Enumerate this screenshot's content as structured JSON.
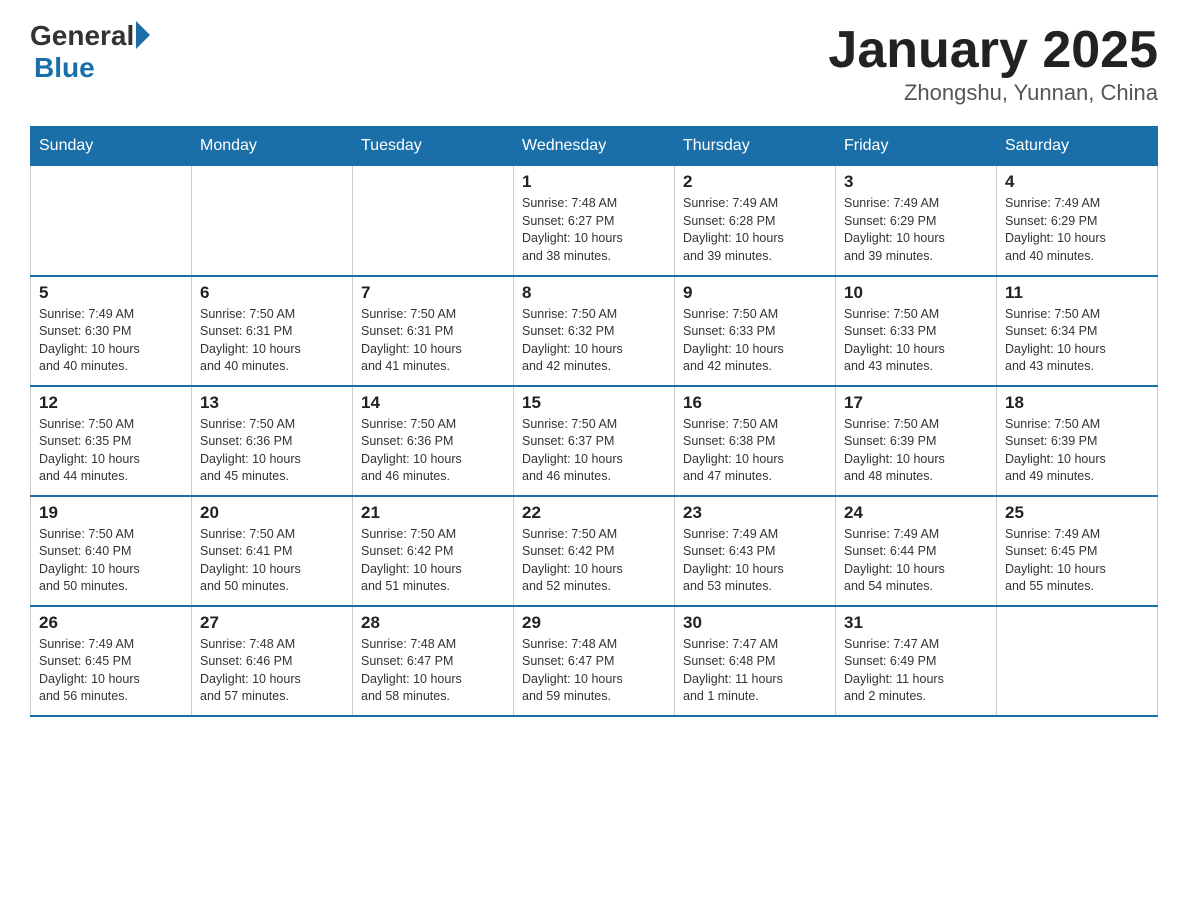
{
  "header": {
    "logo_general": "General",
    "logo_blue": "Blue",
    "month_title": "January 2025",
    "location": "Zhongshu, Yunnan, China"
  },
  "days_of_week": [
    "Sunday",
    "Monday",
    "Tuesday",
    "Wednesday",
    "Thursday",
    "Friday",
    "Saturday"
  ],
  "weeks": [
    [
      {
        "day": "",
        "info": ""
      },
      {
        "day": "",
        "info": ""
      },
      {
        "day": "",
        "info": ""
      },
      {
        "day": "1",
        "info": "Sunrise: 7:48 AM\nSunset: 6:27 PM\nDaylight: 10 hours\nand 38 minutes."
      },
      {
        "day": "2",
        "info": "Sunrise: 7:49 AM\nSunset: 6:28 PM\nDaylight: 10 hours\nand 39 minutes."
      },
      {
        "day": "3",
        "info": "Sunrise: 7:49 AM\nSunset: 6:29 PM\nDaylight: 10 hours\nand 39 minutes."
      },
      {
        "day": "4",
        "info": "Sunrise: 7:49 AM\nSunset: 6:29 PM\nDaylight: 10 hours\nand 40 minutes."
      }
    ],
    [
      {
        "day": "5",
        "info": "Sunrise: 7:49 AM\nSunset: 6:30 PM\nDaylight: 10 hours\nand 40 minutes."
      },
      {
        "day": "6",
        "info": "Sunrise: 7:50 AM\nSunset: 6:31 PM\nDaylight: 10 hours\nand 40 minutes."
      },
      {
        "day": "7",
        "info": "Sunrise: 7:50 AM\nSunset: 6:31 PM\nDaylight: 10 hours\nand 41 minutes."
      },
      {
        "day": "8",
        "info": "Sunrise: 7:50 AM\nSunset: 6:32 PM\nDaylight: 10 hours\nand 42 minutes."
      },
      {
        "day": "9",
        "info": "Sunrise: 7:50 AM\nSunset: 6:33 PM\nDaylight: 10 hours\nand 42 minutes."
      },
      {
        "day": "10",
        "info": "Sunrise: 7:50 AM\nSunset: 6:33 PM\nDaylight: 10 hours\nand 43 minutes."
      },
      {
        "day": "11",
        "info": "Sunrise: 7:50 AM\nSunset: 6:34 PM\nDaylight: 10 hours\nand 43 minutes."
      }
    ],
    [
      {
        "day": "12",
        "info": "Sunrise: 7:50 AM\nSunset: 6:35 PM\nDaylight: 10 hours\nand 44 minutes."
      },
      {
        "day": "13",
        "info": "Sunrise: 7:50 AM\nSunset: 6:36 PM\nDaylight: 10 hours\nand 45 minutes."
      },
      {
        "day": "14",
        "info": "Sunrise: 7:50 AM\nSunset: 6:36 PM\nDaylight: 10 hours\nand 46 minutes."
      },
      {
        "day": "15",
        "info": "Sunrise: 7:50 AM\nSunset: 6:37 PM\nDaylight: 10 hours\nand 46 minutes."
      },
      {
        "day": "16",
        "info": "Sunrise: 7:50 AM\nSunset: 6:38 PM\nDaylight: 10 hours\nand 47 minutes."
      },
      {
        "day": "17",
        "info": "Sunrise: 7:50 AM\nSunset: 6:39 PM\nDaylight: 10 hours\nand 48 minutes."
      },
      {
        "day": "18",
        "info": "Sunrise: 7:50 AM\nSunset: 6:39 PM\nDaylight: 10 hours\nand 49 minutes."
      }
    ],
    [
      {
        "day": "19",
        "info": "Sunrise: 7:50 AM\nSunset: 6:40 PM\nDaylight: 10 hours\nand 50 minutes."
      },
      {
        "day": "20",
        "info": "Sunrise: 7:50 AM\nSunset: 6:41 PM\nDaylight: 10 hours\nand 50 minutes."
      },
      {
        "day": "21",
        "info": "Sunrise: 7:50 AM\nSunset: 6:42 PM\nDaylight: 10 hours\nand 51 minutes."
      },
      {
        "day": "22",
        "info": "Sunrise: 7:50 AM\nSunset: 6:42 PM\nDaylight: 10 hours\nand 52 minutes."
      },
      {
        "day": "23",
        "info": "Sunrise: 7:49 AM\nSunset: 6:43 PM\nDaylight: 10 hours\nand 53 minutes."
      },
      {
        "day": "24",
        "info": "Sunrise: 7:49 AM\nSunset: 6:44 PM\nDaylight: 10 hours\nand 54 minutes."
      },
      {
        "day": "25",
        "info": "Sunrise: 7:49 AM\nSunset: 6:45 PM\nDaylight: 10 hours\nand 55 minutes."
      }
    ],
    [
      {
        "day": "26",
        "info": "Sunrise: 7:49 AM\nSunset: 6:45 PM\nDaylight: 10 hours\nand 56 minutes."
      },
      {
        "day": "27",
        "info": "Sunrise: 7:48 AM\nSunset: 6:46 PM\nDaylight: 10 hours\nand 57 minutes."
      },
      {
        "day": "28",
        "info": "Sunrise: 7:48 AM\nSunset: 6:47 PM\nDaylight: 10 hours\nand 58 minutes."
      },
      {
        "day": "29",
        "info": "Sunrise: 7:48 AM\nSunset: 6:47 PM\nDaylight: 10 hours\nand 59 minutes."
      },
      {
        "day": "30",
        "info": "Sunrise: 7:47 AM\nSunset: 6:48 PM\nDaylight: 11 hours\nand 1 minute."
      },
      {
        "day": "31",
        "info": "Sunrise: 7:47 AM\nSunset: 6:49 PM\nDaylight: 11 hours\nand 2 minutes."
      },
      {
        "day": "",
        "info": ""
      }
    ]
  ]
}
